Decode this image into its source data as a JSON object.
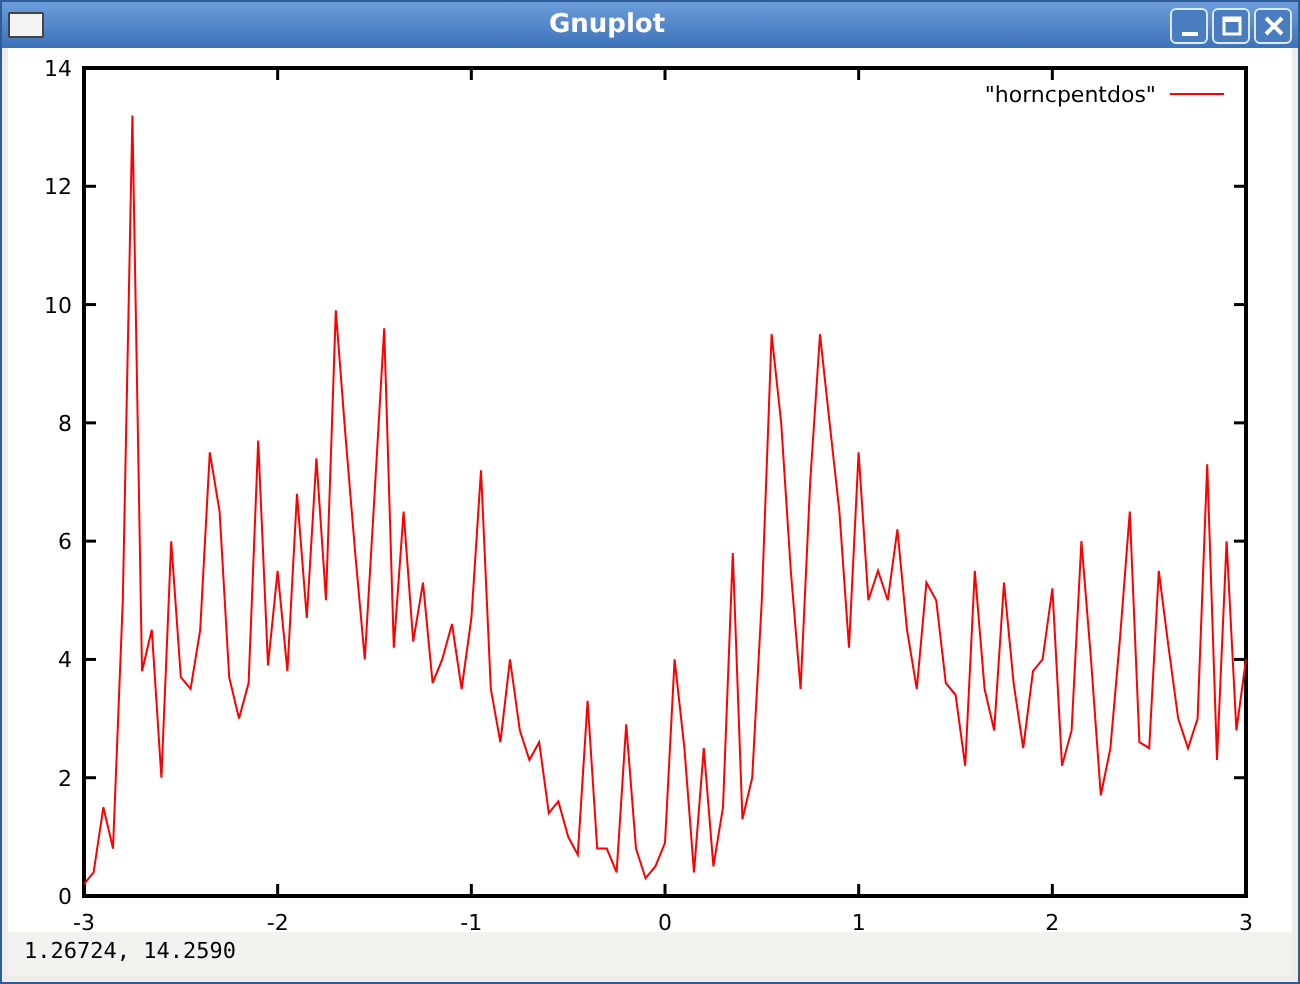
{
  "window": {
    "title": "Gnuplot"
  },
  "plot": {
    "chart_data": {
      "type": "line",
      "xlim": [
        -3,
        3
      ],
      "ylim": [
        0,
        14
      ],
      "xticks": [
        -3,
        -2,
        -1,
        0,
        1,
        2,
        3
      ],
      "yticks": [
        0,
        2,
        4,
        6,
        8,
        10,
        12,
        14
      ],
      "x": [
        -3,
        -2.95,
        -2.9,
        -2.85,
        -2.8,
        -2.75,
        -2.7,
        -2.65,
        -2.6,
        -2.55,
        -2.5,
        -2.45,
        -2.4,
        -2.35,
        -2.3,
        -2.25,
        -2.2,
        -2.15,
        -2.1,
        -2.05,
        -2,
        -1.95,
        -1.9,
        -1.85,
        -1.8,
        -1.75,
        -1.7,
        -1.65,
        -1.6,
        -1.55,
        -1.5,
        -1.45,
        -1.4,
        -1.35,
        -1.3,
        -1.25,
        -1.2,
        -1.15,
        -1.1,
        -1.05,
        -1,
        -0.95,
        -0.9,
        -0.85,
        -0.8,
        -0.75,
        -0.7,
        -0.65,
        -0.6,
        -0.55,
        -0.5,
        -0.45,
        -0.4,
        -0.35,
        -0.3,
        -0.25,
        -0.2,
        -0.15,
        -0.1,
        -0.05,
        0,
        0.05,
        0.1,
        0.15,
        0.2,
        0.25,
        0.3,
        0.35,
        0.4,
        0.45,
        0.5,
        0.55,
        0.6,
        0.65,
        0.7,
        0.75,
        0.8,
        0.85,
        0.9,
        0.95,
        1,
        1.05,
        1.1,
        1.15,
        1.2,
        1.25,
        1.3,
        1.35,
        1.4,
        1.45,
        1.5,
        1.55,
        1.6,
        1.65,
        1.7,
        1.75,
        1.8,
        1.85,
        1.9,
        1.95,
        2,
        2.05,
        2.1,
        2.15,
        2.2,
        2.25,
        2.3,
        2.35,
        2.4,
        2.45,
        2.5,
        2.55,
        2.6,
        2.65,
        2.7,
        2.75,
        2.8,
        2.85,
        2.9,
        2.95,
        3
      ],
      "series": [
        {
          "name": "\"horncpentdos\"",
          "color": "#ff0000",
          "values": [
            0.2,
            0.4,
            1.5,
            0.8,
            5.0,
            13.2,
            3.8,
            4.5,
            2.0,
            6.0,
            3.7,
            3.5,
            4.5,
            7.5,
            6.5,
            3.7,
            3.0,
            3.6,
            7.7,
            3.9,
            5.5,
            3.8,
            6.8,
            4.7,
            7.4,
            5.0,
            9.9,
            7.8,
            5.8,
            4.0,
            6.8,
            9.6,
            4.2,
            6.5,
            4.3,
            5.3,
            3.6,
            4.0,
            4.6,
            3.5,
            4.7,
            7.2,
            3.5,
            2.6,
            4.0,
            2.8,
            2.3,
            2.6,
            1.4,
            1.6,
            1.0,
            0.7,
            3.3,
            0.8,
            0.8,
            0.4,
            2.9,
            0.8,
            0.3,
            0.5,
            0.9,
            4.0,
            2.5,
            0.4,
            2.5,
            0.5,
            1.5,
            5.8,
            1.3,
            2.0,
            5.0,
            9.5,
            8.0,
            5.5,
            3.5,
            7.0,
            9.5,
            8.0,
            6.5,
            4.2,
            7.5,
            5.0,
            5.5,
            5.0,
            6.2,
            4.5,
            3.5,
            5.3,
            5.0,
            3.6,
            3.4,
            2.2,
            5.5,
            3.5,
            2.8,
            5.3,
            3.6,
            2.5,
            3.8,
            4.0,
            5.2,
            2.2,
            2.8,
            6.0,
            4.0,
            1.7,
            2.5,
            4.4,
            6.5,
            2.6,
            2.5,
            5.5,
            4.2,
            3.0,
            2.5,
            3.0,
            7.3,
            2.3,
            6.0,
            2.8,
            4.0
          ]
        }
      ]
    }
  },
  "status_bar": "1.26724,  14.2590"
}
